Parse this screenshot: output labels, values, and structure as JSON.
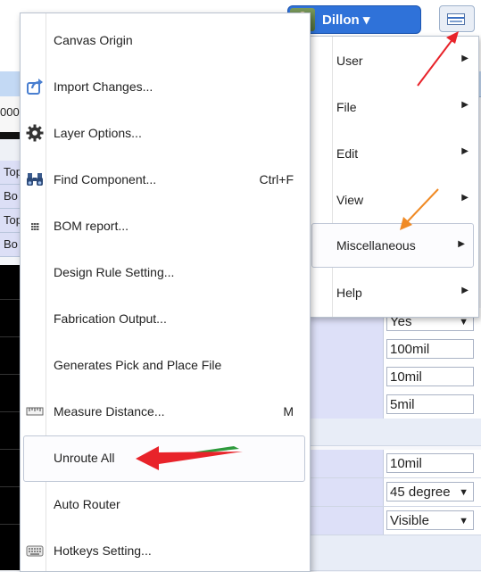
{
  "header": {
    "user_name": "Dillon",
    "user_caret": "▾"
  },
  "background": {
    "ruler_label": "000",
    "layer_rows": [
      "Top",
      "Bo",
      "Top",
      "Bo"
    ],
    "properties": [
      {
        "value": "Yes",
        "dropdown": true
      },
      {
        "value": "100mil",
        "dropdown": false
      },
      {
        "value": "10mil",
        "dropdown": false
      },
      {
        "value": "5mil",
        "dropdown": false
      },
      {
        "value": "10mil",
        "dropdown": false
      },
      {
        "value": "45 degree",
        "dropdown": true
      },
      {
        "value": "Visible",
        "dropdown": true
      }
    ]
  },
  "main_menu": {
    "items": [
      {
        "label": "User",
        "arrow": "▶"
      },
      {
        "label": "File",
        "arrow": "▶"
      },
      {
        "label": "Edit",
        "arrow": "▶"
      },
      {
        "label": "View",
        "arrow": "▶"
      },
      {
        "label": "Miscellaneous",
        "arrow": "▶"
      },
      {
        "label": "Help",
        "arrow": "▶"
      }
    ]
  },
  "sub_menu": {
    "items": [
      {
        "label": "Canvas Origin",
        "shortcut": "",
        "icon": "none"
      },
      {
        "label": "Import Changes...",
        "shortcut": "",
        "icon": "import-icon"
      },
      {
        "label": "Layer Options...",
        "shortcut": "",
        "icon": "gear-icon"
      },
      {
        "label": "Find Component...",
        "shortcut": "Ctrl+F",
        "icon": "binoculars-icon"
      },
      {
        "label": "BOM report...",
        "shortcut": "",
        "icon": "grid-icon"
      },
      {
        "label": "Design Rule Setting...",
        "shortcut": "",
        "icon": "none"
      },
      {
        "label": "Fabrication Output...",
        "shortcut": "",
        "icon": "none"
      },
      {
        "label": "Generates Pick and Place File",
        "shortcut": "",
        "icon": "none"
      },
      {
        "label": "Measure Distance...",
        "shortcut": "M",
        "icon": "ruler-icon"
      },
      {
        "label": "Unroute All",
        "shortcut": "",
        "icon": "none"
      },
      {
        "label": "Auto Router",
        "shortcut": "",
        "icon": "none"
      },
      {
        "label": "Hotkeys Setting...",
        "shortcut": "",
        "icon": "keyboard-icon"
      }
    ]
  },
  "colors": {
    "accent": "#2f72d9",
    "annotation_red": "#e8232a",
    "annotation_orange": "#f08a24",
    "annotation_green": "#2e9a3c"
  }
}
